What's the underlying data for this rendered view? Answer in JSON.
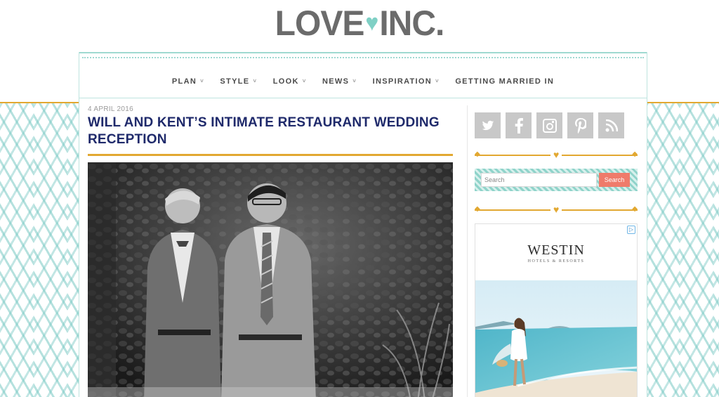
{
  "logo": {
    "left": "LOVE",
    "right": "INC."
  },
  "nav": {
    "items": [
      {
        "label": "PLAN",
        "caret": "˅"
      },
      {
        "label": "STYLE",
        "caret": "˅"
      },
      {
        "label": "LOOK",
        "caret": "˅"
      },
      {
        "label": "NEWS",
        "caret": "˅"
      },
      {
        "label": "INSPIRATION",
        "caret": "˅"
      },
      {
        "label": "GETTING MARRIED IN",
        "caret": ""
      }
    ]
  },
  "article": {
    "date": "4 APRIL 2016",
    "title": "WILL AND KENT’S INTIMATE RESTAURANT WEDDING RECEPTION"
  },
  "sidebar": {
    "social": [
      {
        "icon": "twitter-icon",
        "glyph": "t"
      },
      {
        "icon": "facebook-icon",
        "glyph": "f"
      },
      {
        "icon": "instagram-icon",
        "glyph": "◙"
      },
      {
        "icon": "pinterest-icon",
        "glyph": "p"
      },
      {
        "icon": "rss-icon",
        "glyph": "◢"
      }
    ],
    "search": {
      "placeholder": "Search",
      "button_label": "Search"
    },
    "ad": {
      "brand": "WESTIN",
      "sub": "HOTELS & RESORTS",
      "choice": "▷"
    }
  },
  "colors": {
    "accent_teal": "#7fd0c5",
    "accent_gold": "#e2a831",
    "title_navy": "#1f2a6b",
    "search_button": "#ef7b6b"
  }
}
